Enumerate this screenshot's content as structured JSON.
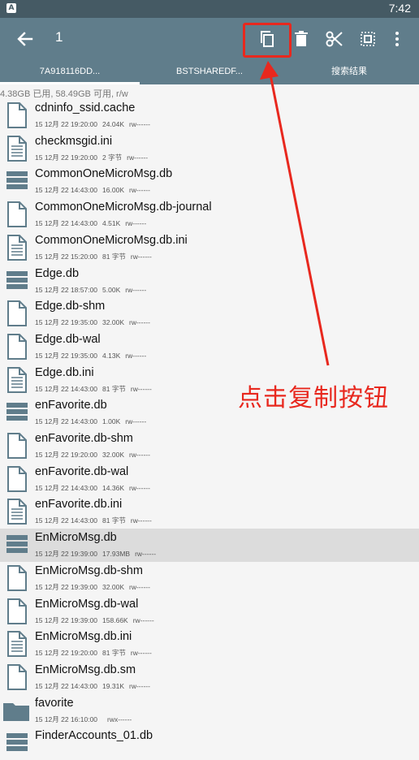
{
  "status_bar": {
    "app_badge": "A",
    "time": "7:42"
  },
  "app_bar": {
    "selected_count": "1",
    "icons": [
      "back-arrow-icon",
      "copy-icon",
      "delete-icon",
      "cut-icon",
      "select-all-icon",
      "more-vert-icon"
    ]
  },
  "tabs": [
    "7A918116DD...",
    "BSTSHAREDF...",
    "搜索结果"
  ],
  "storage_info": "4.38GB 已用, 58.49GB 可用, r/w",
  "files": [
    {
      "name": "cdninfo_ssid.cache",
      "date": "15 12月 22 19:20:00",
      "size": "24.04K",
      "perm": "rw------",
      "icon": "file-icon"
    },
    {
      "name": "checkmsgid.ini",
      "date": "15 12月 22 19:20:00",
      "size": "2 字节",
      "perm": "rw------",
      "icon": "text-file-icon"
    },
    {
      "name": "CommonOneMicroMsg.db",
      "date": "15 12月 22 14:43:00",
      "size": "16.00K",
      "perm": "rw------",
      "icon": "database-icon"
    },
    {
      "name": "CommonOneMicroMsg.db-journal",
      "date": "15 12月 22 14:43:00",
      "size": "4.51K",
      "perm": "rw------",
      "icon": "file-icon"
    },
    {
      "name": "CommonOneMicroMsg.db.ini",
      "date": "15 12月 22 15:20:00",
      "size": "81 字节",
      "perm": "rw------",
      "icon": "text-file-icon"
    },
    {
      "name": "Edge.db",
      "date": "15 12月 22 18:57:00",
      "size": "5.00K",
      "perm": "rw------",
      "icon": "database-icon"
    },
    {
      "name": "Edge.db-shm",
      "date": "15 12月 22 19:35:00",
      "size": "32.00K",
      "perm": "rw------",
      "icon": "file-icon"
    },
    {
      "name": "Edge.db-wal",
      "date": "15 12月 22 19:35:00",
      "size": "4.13K",
      "perm": "rw------",
      "icon": "file-icon"
    },
    {
      "name": "Edge.db.ini",
      "date": "15 12月 22 14:43:00",
      "size": "81 字节",
      "perm": "rw------",
      "icon": "text-file-icon"
    },
    {
      "name": "enFavorite.db",
      "date": "15 12月 22 14:43:00",
      "size": "1.00K",
      "perm": "rw------",
      "icon": "database-icon"
    },
    {
      "name": "enFavorite.db-shm",
      "date": "15 12月 22 19:20:00",
      "size": "32.00K",
      "perm": "rw------",
      "icon": "file-icon"
    },
    {
      "name": "enFavorite.db-wal",
      "date": "15 12月 22 14:43:00",
      "size": "14.36K",
      "perm": "rw------",
      "icon": "file-icon"
    },
    {
      "name": "enFavorite.db.ini",
      "date": "15 12月 22 14:43:00",
      "size": "81 字节",
      "perm": "rw------",
      "icon": "text-file-icon"
    },
    {
      "name": "EnMicroMsg.db",
      "date": "15 12月 22 19:39:00",
      "size": "17.93MB",
      "perm": "rw------",
      "icon": "database-icon",
      "selected": true
    },
    {
      "name": "EnMicroMsg.db-shm",
      "date": "15 12月 22 19:39:00",
      "size": "32.00K",
      "perm": "rw------",
      "icon": "file-icon"
    },
    {
      "name": "EnMicroMsg.db-wal",
      "date": "15 12月 22 19:39:00",
      "size": "158.66K",
      "perm": "rw------",
      "icon": "file-icon"
    },
    {
      "name": "EnMicroMsg.db.ini",
      "date": "15 12月 22 19:20:00",
      "size": "81 字节",
      "perm": "rw------",
      "icon": "text-file-icon"
    },
    {
      "name": "EnMicroMsg.db.sm",
      "date": "15 12月 22 14:43:00",
      "size": "19.31K",
      "perm": "rw------",
      "icon": "file-icon"
    },
    {
      "name": "favorite",
      "date": "15 12月 22 16:10:00",
      "size": "",
      "perm": "rwx------",
      "icon": "folder-icon"
    },
    {
      "name": "FinderAccounts_01.db",
      "date": "",
      "size": "",
      "perm": "",
      "icon": "database-icon"
    }
  ],
  "annotation": {
    "text": "点击复制按钮",
    "color": "#e8281e"
  },
  "colors": {
    "toolbar": "#607d8b",
    "statusbar": "#455a64",
    "icon": "#607d8b",
    "selected_row": "#dcdcdc"
  }
}
